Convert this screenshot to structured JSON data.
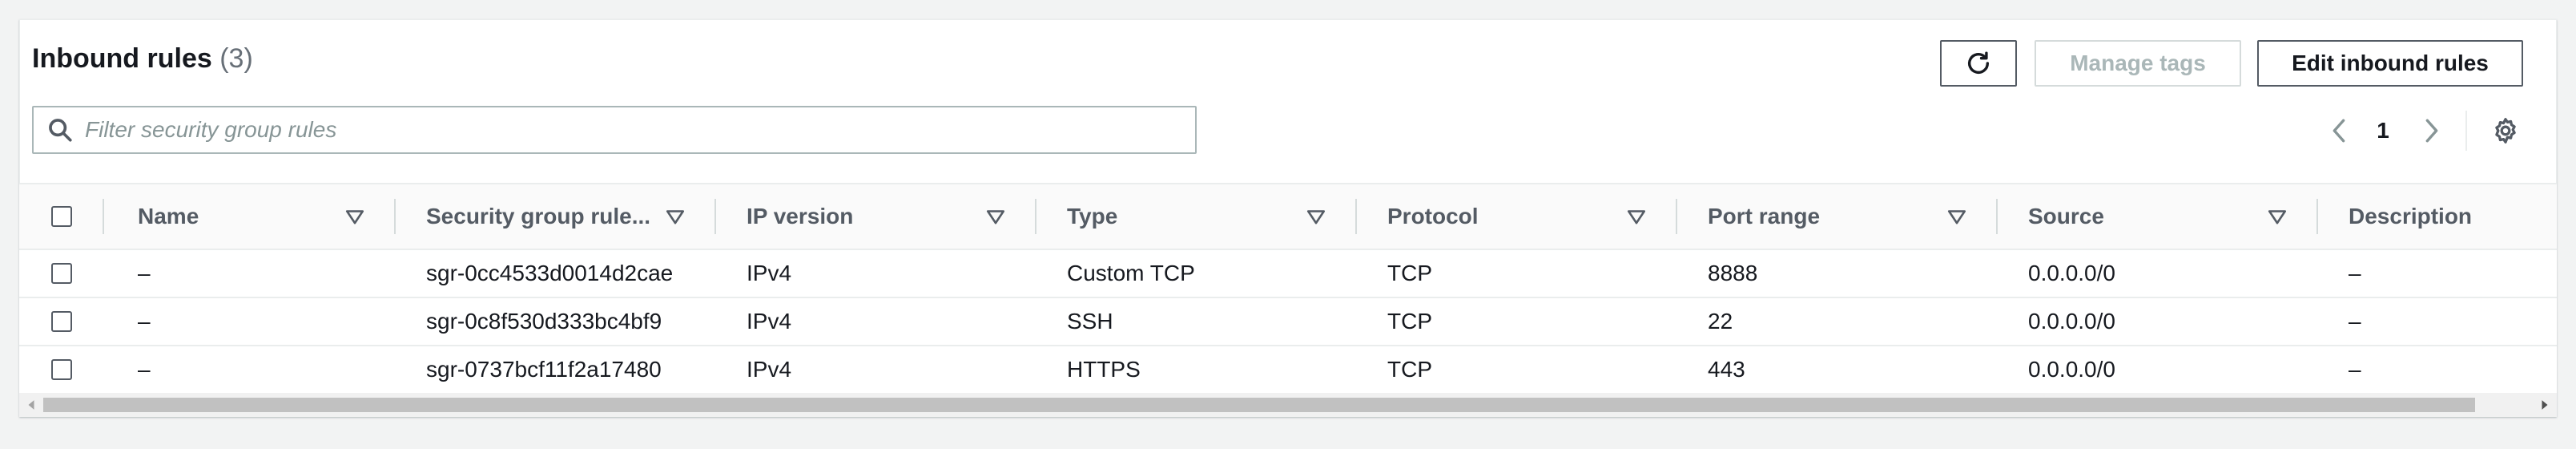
{
  "header": {
    "title": "Inbound rules",
    "count": "(3)"
  },
  "actions": {
    "manage_tags_label": "Manage tags",
    "edit_label": "Edit inbound rules"
  },
  "filter": {
    "placeholder": "Filter security group rules",
    "value": ""
  },
  "pagination": {
    "current_page": "1"
  },
  "table": {
    "columns": [
      "Name",
      "Security group rule...",
      "IP version",
      "Type",
      "Protocol",
      "Port range",
      "Source",
      "Description"
    ],
    "rows": [
      [
        "–",
        "sgr-0cc4533d0014d2cae",
        "IPv4",
        "Custom TCP",
        "TCP",
        "8888",
        "0.0.0.0/0",
        "–"
      ],
      [
        "–",
        "sgr-0c8f530d333bc4bf9",
        "IPv4",
        "SSH",
        "TCP",
        "22",
        "0.0.0.0/0",
        "–"
      ],
      [
        "–",
        "sgr-0737bcf11f2a17480",
        "IPv4",
        "HTTPS",
        "TCP",
        "443",
        "0.0.0.0/0",
        "–"
      ]
    ]
  },
  "icons": {
    "refresh": "refresh-icon",
    "search": "search-icon",
    "prev": "chevron-left-icon",
    "next": "chevron-right-icon",
    "settings": "gear-icon",
    "sort": "caret-down-outline-icon"
  },
  "colors": {
    "text": "#16191f",
    "muted": "#545b64",
    "disabled": "#aab7b8",
    "border": "#eaeded"
  }
}
